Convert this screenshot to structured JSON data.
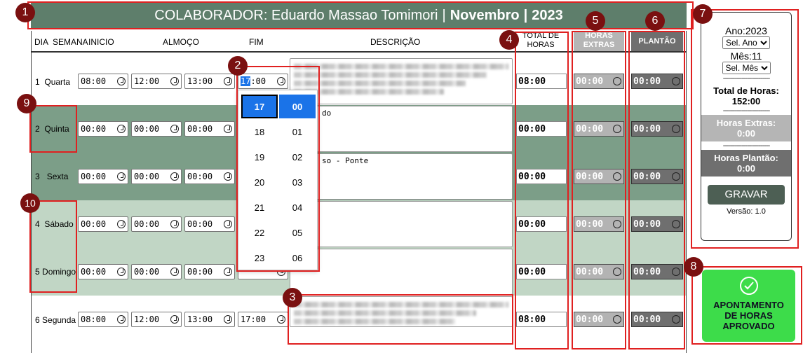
{
  "header": {
    "prefix": "COLABORADOR: Eduardo Massao Tomimori",
    "separator": "|",
    "month": "Novembro",
    "separator2": "|",
    "year": "2023"
  },
  "columns": {
    "dia": "DIA",
    "semana": "SEMANA",
    "inicio": "INICIO",
    "almoco": "ALMOÇO",
    "fim": "FIM",
    "descricao": "DESCRIÇÃO",
    "total": "TOTAL DE HORAS",
    "extras": "HORAS EXTRAS",
    "plantao": "PLANTÃO"
  },
  "rows": [
    {
      "num": "1",
      "day": "Quarta",
      "inicio": "08:00",
      "almoco": "12:00",
      "almoco_fim": "13:00",
      "fim": "17:00",
      "desc": "",
      "total": "08:00",
      "extra": "00:00",
      "plantao": "00:00"
    },
    {
      "num": "2",
      "day": "Quinta",
      "inicio": "00:00",
      "almoco": "00:00",
      "almoco_fim": "00:00",
      "fim": "",
      "desc": "do",
      "total": "00:00",
      "extra": "00:00",
      "plantao": "00:00"
    },
    {
      "num": "3",
      "day": "Sexta",
      "inicio": "00:00",
      "almoco": "00:00",
      "almoco_fim": "00:00",
      "fim": "",
      "desc": "so - Ponte",
      "total": "00:00",
      "extra": "00:00",
      "plantao": "00:00"
    },
    {
      "num": "4",
      "day": "Sábado",
      "inicio": "00:00",
      "almoco": "00:00",
      "almoco_fim": "00:00",
      "fim": "",
      "desc": "",
      "total": "00:00",
      "extra": "00:00",
      "plantao": "00:00"
    },
    {
      "num": "5",
      "day": "Domingo",
      "inicio": "00:00",
      "almoco": "00:00",
      "almoco_fim": "00:00",
      "fim": "",
      "desc": "",
      "total": "00:00",
      "extra": "00:00",
      "plantao": "00:00"
    },
    {
      "num": "6",
      "day": "Segunda",
      "inicio": "08:00",
      "almoco": "12:00",
      "almoco_fim": "13:00",
      "fim": "17:00",
      "desc": "",
      "total": "08:00",
      "extra": "00:00",
      "plantao": "00:00"
    }
  ],
  "picker": {
    "hours": [
      "17",
      "18",
      "19",
      "20",
      "21",
      "22",
      "23"
    ],
    "minutes": [
      "00",
      "01",
      "02",
      "03",
      "04",
      "05",
      "06"
    ],
    "field_value_hour": "17",
    "field_value_rest": ":00"
  },
  "side": {
    "ano_label": "Ano:2023",
    "ano_select": "Sel. Ano",
    "mes_label": "Mês:11",
    "mes_select": "Sel. Mês",
    "dashes": "-------------------------",
    "total_label": "Total de Horas:",
    "total_value": "152:00",
    "extras_label": "Horas Extras:",
    "extras_value": "0:00",
    "plantao_label": "Horas Plantão:",
    "plantao_value": "0:00",
    "gravar": "GRAVAR",
    "versao": "Versão: 1.0"
  },
  "approved": {
    "line1": "APONTAMENTO",
    "line2": "DE HORAS",
    "line3": "APROVADO"
  },
  "badges": [
    "1",
    "2",
    "3",
    "4",
    "5",
    "6",
    "7",
    "8",
    "9",
    "10"
  ],
  "colors": {
    "header_bg": "#5e7e6b",
    "row_dark": "#7c9e88",
    "row_light": "#c1d6c5",
    "accent_red": "#e02020",
    "picker_blue": "#1a73e8",
    "approved_green": "#3ddc4a"
  }
}
